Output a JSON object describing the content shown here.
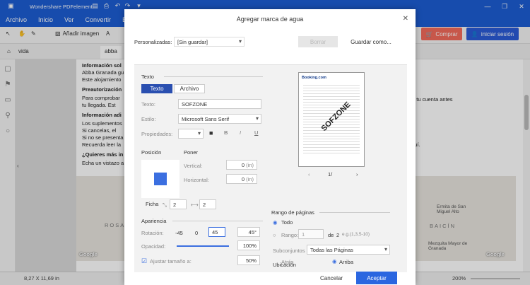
{
  "app": {
    "title": "Wondershare PDFelement",
    "menu": [
      "Archivo",
      "Inicio",
      "Ver",
      "Convertir",
      "E"
    ],
    "toolbar": {
      "add_image": "Añadir imagen",
      "add_text": "A"
    },
    "buy_label": "Comprar",
    "login_label": "iniciar sesión",
    "tabs": [
      "vida",
      "abba"
    ],
    "status": {
      "dims": "8,27 X 11,69 in",
      "zoom": "200%"
    }
  },
  "document": {
    "lines": [
      {
        "text": "Información sol",
        "bold": true
      },
      {
        "text": "Abba Granada gu",
        "bold": false
      },
      {
        "text": "Este alojamiento",
        "bold": false
      },
      {
        "text": "Preautorización",
        "bold": true
      },
      {
        "text": "Para comprobar",
        "bold": false
      },
      {
        "text": "tu llegada. Est",
        "bold": false
      },
      {
        "text": "Información adi",
        "bold": true
      },
      {
        "text": "Los suplementos",
        "bold": false
      },
      {
        "text": "Si cancelas, el",
        "bold": false
      },
      {
        "text": "Si no se presenta",
        "bold": false
      },
      {
        "text": "Recuerda leer la",
        "bold": false
      },
      {
        "text": "¿Quieres más in",
        "bold": true
      },
      {
        "text": "Echa un vistazo a",
        "bold": false
      }
    ],
    "right_lines": [
      "n tu cuenta antes",
      "aquí."
    ],
    "map_labels": {
      "left": "ROSA",
      "google_left": "Google",
      "ermita": "Ermita de San Miguel Alto",
      "baicin": "BAICÍN",
      "mezquita": "Mezquita Mayor de Granada",
      "google_right": "Google"
    }
  },
  "dialog": {
    "title": "Agregar marca de agua",
    "personalizadas_label": "Personalizadas:",
    "personalizadas_value": "[Sin guardar]",
    "borrar_label": "Borrar",
    "guardar_como_label": "Guardar como...",
    "texto_section": "Texto",
    "tab_texto": "Texto",
    "tab_archivo": "Archivo",
    "texto_label": "Texto:",
    "texto_value": "SOFZONE",
    "estilo_label": "Estilo:",
    "estilo_value": "Microsoft Sans Serif",
    "propiedades_label": "Propiedades:",
    "posicion_label": "Posición",
    "poner_label": "Poner",
    "vertical_label": "Vertical:",
    "vertical_value": "0",
    "horizontal_label": "Horizontal:",
    "horizontal_value": "0",
    "unit_in": "(in)",
    "ficha_label": "Ficha",
    "ficha_v1": "2",
    "ficha_v2": "2",
    "apariencia_label": "Apariencia",
    "rotacion_label": "Rotación:",
    "rot_options": [
      "-45",
      "0",
      "45"
    ],
    "rot_value": "45",
    "degree": "°",
    "opacidad_label": "Opacidad:",
    "opacidad_value": "100",
    "opacidad_fraction": 1.0,
    "ajustar_label": "Ajustar tamaño a:",
    "ajustar_value": "50",
    "percent": "%",
    "preview_page": "1/",
    "preview_watermark": "SOFZONE",
    "preview_logo": "Booking.com",
    "rango_label": "Rango de páginas",
    "todo_label": "Todo",
    "rango_option": "Rango:",
    "rango_from": "1",
    "de_label": "de",
    "rango_to": "2",
    "rango_hint": "e.g.(1,3,5-10)",
    "subconjuntos_label": "Subconjuntos",
    "subconjuntos_value": "Todas las Páginas",
    "ubicacion_label": "Ubicación",
    "atras_label": "Atrás",
    "arriba_label": "Arriba",
    "cancelar_label": "Cancelar",
    "aceptar_label": "Aceptar",
    "accent": "#3b6fe0"
  }
}
